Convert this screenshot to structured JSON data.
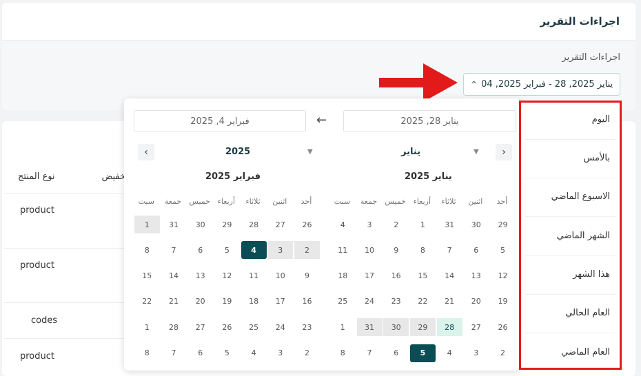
{
  "header": {
    "title": "اجراءات التقرير"
  },
  "filter": {
    "label": "اجراءات التقرير",
    "range_text": "يناير 2025, 28 - فبراير 2025, 04",
    "caret": "^"
  },
  "table": {
    "headers": [
      "نوع المنتج",
      "تخفيض"
    ],
    "rows": [
      "product",
      "product",
      "codes",
      "product"
    ]
  },
  "calendar": {
    "date_from": "يناير 28, 2025",
    "date_to": "فبراير 4, 2025",
    "arrow": "←",
    "prev": "‹",
    "next": "›",
    "month_select": "يناير",
    "year_select": "2025",
    "weekdays": [
      "أحد",
      "اثنين",
      "ثلاثاء",
      "أربعاء",
      "خميس",
      "جمعة",
      "سبت"
    ],
    "right_month": {
      "title": "يناير 2025",
      "days": [
        [
          "29",
          "30",
          "31",
          "1",
          "2",
          "3",
          "4"
        ],
        [
          "5",
          "6",
          "7",
          "8",
          "9",
          "10",
          "11"
        ],
        [
          "12",
          "13",
          "14",
          "15",
          "16",
          "17",
          "18"
        ],
        [
          "19",
          "20",
          "21",
          "22",
          "23",
          "24",
          "25"
        ],
        [
          "26",
          "27",
          "28",
          "29",
          "30",
          "31",
          "1"
        ],
        [
          "2",
          "3",
          "4",
          "5",
          "6",
          "7",
          "8"
        ]
      ]
    },
    "left_month": {
      "title": "فبراير 2025",
      "days": [
        [
          "26",
          "27",
          "28",
          "29",
          "30",
          "31",
          "1"
        ],
        [
          "2",
          "3",
          "4",
          "5",
          "6",
          "7",
          "8"
        ],
        [
          "9",
          "10",
          "11",
          "12",
          "13",
          "14",
          "15"
        ],
        [
          "16",
          "17",
          "18",
          "19",
          "20",
          "21",
          "22"
        ],
        [
          "23",
          "24",
          "25",
          "26",
          "27",
          "28",
          "1"
        ],
        [
          "2",
          "3",
          "4",
          "5",
          "6",
          "7",
          "8"
        ]
      ]
    }
  },
  "presets": [
    "اليوم",
    "بالأمس",
    "الاسبوع الماضي",
    "الشهر الماضي",
    "هذا الشهر",
    "العام الحالي",
    "العام الماضي"
  ],
  "colors": {
    "accent": "#0b4d55",
    "highlight": "#e31a1a",
    "today": "#dbf3ea"
  }
}
